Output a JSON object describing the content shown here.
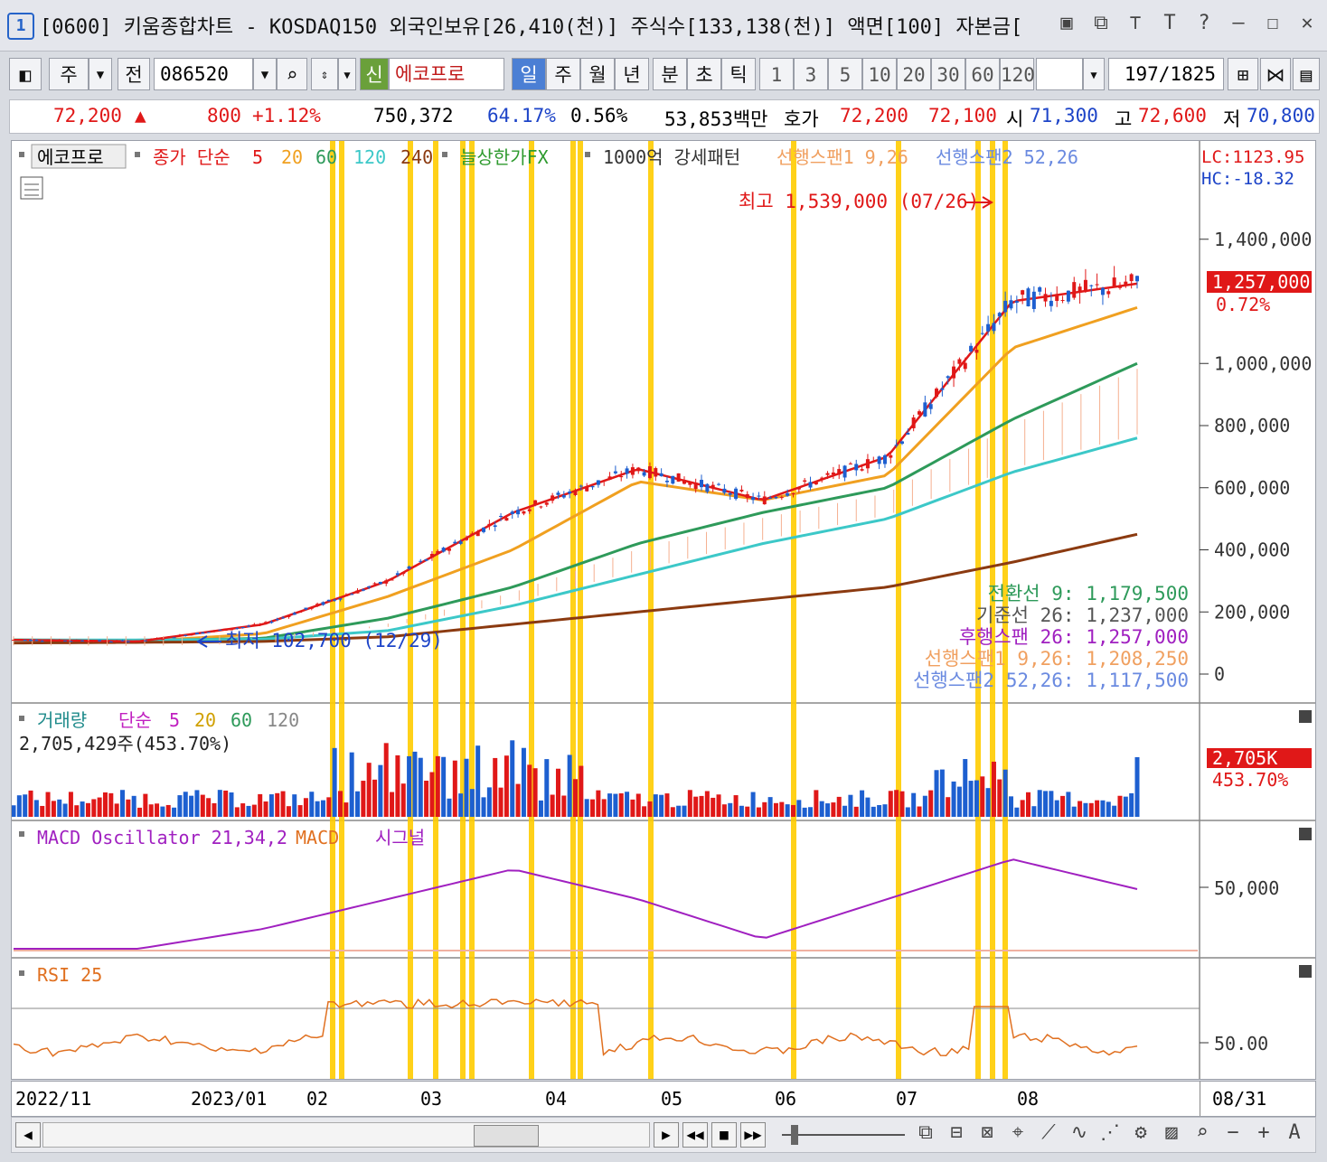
{
  "window": {
    "number": "1",
    "title": "[0600] 키움종합차트 - KOSDAQ150 외국인보유[26,410(천)] 주식수[133,138(천)] 액면[100] 자본금["
  },
  "toolbar": {
    "market": "주",
    "prev_btn": "전",
    "code": "086520",
    "new_badge": "신",
    "stock_name": "에코프로",
    "periods": [
      "일",
      "주",
      "월",
      "년",
      "분",
      "초",
      "틱"
    ],
    "active_period": "일",
    "intervals": [
      "1",
      "3",
      "5",
      "10",
      "20",
      "30",
      "60",
      "120"
    ],
    "count_current": "197",
    "count_total": "/1825"
  },
  "quote": {
    "price": "72,200",
    "up_arrow": "▲",
    "change": "800",
    "change_pct": "+1.12%",
    "volume": "750,372",
    "volume_pct": "64.17%",
    "turnover": "0.56%",
    "amount": "53,853백만",
    "hoga_label": "호가",
    "ask": "72,200",
    "bid": "72,100",
    "open_label": "시",
    "open": "71,300",
    "high_label": "고",
    "high": "72,600",
    "low_label": "저",
    "low": "70,800"
  },
  "price_panel": {
    "legend_name": "에코프로",
    "legend_close": "종가 단순",
    "ma_periods": [
      "5",
      "20",
      "60",
      "120",
      "240"
    ],
    "ma_colors": [
      "#e01818",
      "#f0a020",
      "#2e9a5a",
      "#3cc8c8",
      "#8b3a10"
    ],
    "legend_limit": "늘상한가FX",
    "legend_pattern": "1000억 강세패턴",
    "legend_span1": "선행스팬1 9,26",
    "legend_span2": "선행스팬2 52,26",
    "lc": "LC:1123.95",
    "hc": "HC:-18.32",
    "high_note": "최고 1,539,000 (07/26)",
    "low_note": "최저 102,700 (12/29)",
    "last_price": "1,257,000",
    "last_pct": "0.72%",
    "y_ticks": [
      "1,400,000",
      "1,000,000",
      "800,000",
      "600,000",
      "400,000",
      "200,000",
      "0"
    ],
    "ichimoku": [
      {
        "label": "전환선 9: 1,179,500",
        "color": "#2e9a5a"
      },
      {
        "label": "기준선 26: 1,237,000",
        "color": "#555555"
      },
      {
        "label": "후행스팬 26: 1,257,000",
        "color": "#a020c0"
      },
      {
        "label": "선행스팬1 9,26: 1,208,250",
        "color": "#f0a060"
      },
      {
        "label": "선행스팬2 52,26: 1,117,500",
        "color": "#6a8ae0"
      }
    ]
  },
  "volume_panel": {
    "legend_name": "거래량",
    "legend_type": "단순",
    "ma_periods": [
      "5",
      "20",
      "60",
      "120"
    ],
    "value": "2,705,429주(453.70%)",
    "last_label": "2,705K",
    "last_pct": "453.70%"
  },
  "macd_panel": {
    "legend": "MACD Oscillator 21,34,2",
    "legend_macd": "MACD",
    "legend_signal": "시그널",
    "y_tick": "50,000"
  },
  "rsi_panel": {
    "legend": "RSI 25",
    "y_tick": "50.00"
  },
  "x_axis": {
    "labels": [
      "2022/11",
      "2023/01",
      "02",
      "03",
      "04",
      "05",
      "06",
      "07",
      "08"
    ],
    "right_label": "08/31"
  },
  "chart_data": {
    "type": "line",
    "title": "에코프로",
    "x": [
      "2022/11",
      "2023/01",
      "02",
      "03",
      "04",
      "05",
      "06",
      "07",
      "08",
      "08/31"
    ],
    "series": [
      {
        "name": "종가",
        "values": [
          110000,
          105000,
          160000,
          300000,
          520000,
          660000,
          560000,
          700000,
          1200000,
          1257000
        ]
      },
      {
        "name": "20",
        "values": [
          110000,
          105000,
          130000,
          250000,
          400000,
          620000,
          560000,
          640000,
          1050000,
          1180000
        ]
      },
      {
        "name": "60",
        "values": [
          110000,
          108000,
          115000,
          180000,
          280000,
          420000,
          520000,
          600000,
          820000,
          1000000
        ]
      },
      {
        "name": "120",
        "values": [
          110000,
          110000,
          112000,
          140000,
          220000,
          320000,
          420000,
          500000,
          650000,
          760000
        ]
      },
      {
        "name": "240",
        "values": [
          100000,
          102000,
          105000,
          120000,
          160000,
          200000,
          240000,
          280000,
          360000,
          450000
        ]
      }
    ],
    "ylim": [
      0,
      1600000
    ],
    "grid": false
  }
}
